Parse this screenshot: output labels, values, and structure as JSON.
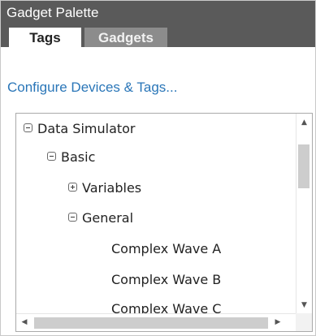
{
  "panel": {
    "title": "Gadget Palette"
  },
  "tabs": [
    {
      "label": "Tags",
      "active": true
    },
    {
      "label": "Gadgets",
      "active": false
    }
  ],
  "configure_link": "Configure Devices & Tags...",
  "tree": {
    "items": [
      {
        "label": "Data Simulator",
        "level": 0,
        "toggle": "expanded"
      },
      {
        "label": "Basic",
        "level": 1,
        "toggle": "expanded"
      },
      {
        "label": "Variables",
        "level": 2,
        "toggle": "collapsed"
      },
      {
        "label": "General",
        "level": 2,
        "toggle": "expanded"
      },
      {
        "label": "Complex Wave A",
        "level": 3,
        "toggle": "none"
      },
      {
        "label": "Complex Wave B",
        "level": 3,
        "toggle": "none"
      },
      {
        "label": "Complex Wave C",
        "level": 3,
        "toggle": "none"
      }
    ]
  },
  "scrollbars": {
    "up_glyph": "▲",
    "down_glyph": "▼",
    "left_glyph": "◀",
    "right_glyph": "▶"
  },
  "colors": {
    "header_bg": "#5a5a5a",
    "inactive_tab_bg": "#8c8c8c",
    "link": "#2a76b8"
  }
}
